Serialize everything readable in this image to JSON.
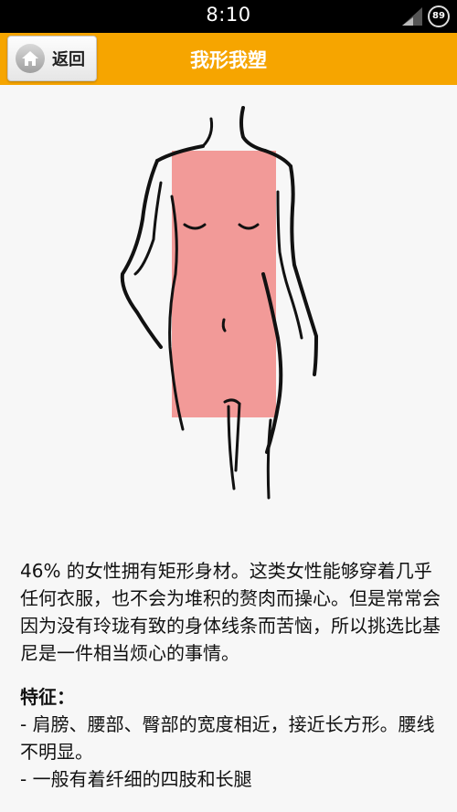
{
  "status_bar": {
    "time": "8:10",
    "battery": "89"
  },
  "title_bar": {
    "back_label": "返回",
    "title": "我形我塑"
  },
  "content": {
    "description": "46% 的女性拥有矩形身材。这类女性能够穿着几乎任何衣服，也不会为堆积的赘肉而操心。但是常常会因为没有玲珑有致的身体线条而苦恼，所以挑选比基尼是一件相当烦心的事情。",
    "features_heading": "特征：",
    "features": [
      "- 肩膀、腰部、臀部的宽度相近，接近长方形。腰线不明显。",
      "- 一般有着纤细的四肢和长腿"
    ]
  },
  "colors": {
    "title_bar": "#f6a500",
    "rectangle_overlay": "#f29a98",
    "background": "#f7f7f7"
  }
}
